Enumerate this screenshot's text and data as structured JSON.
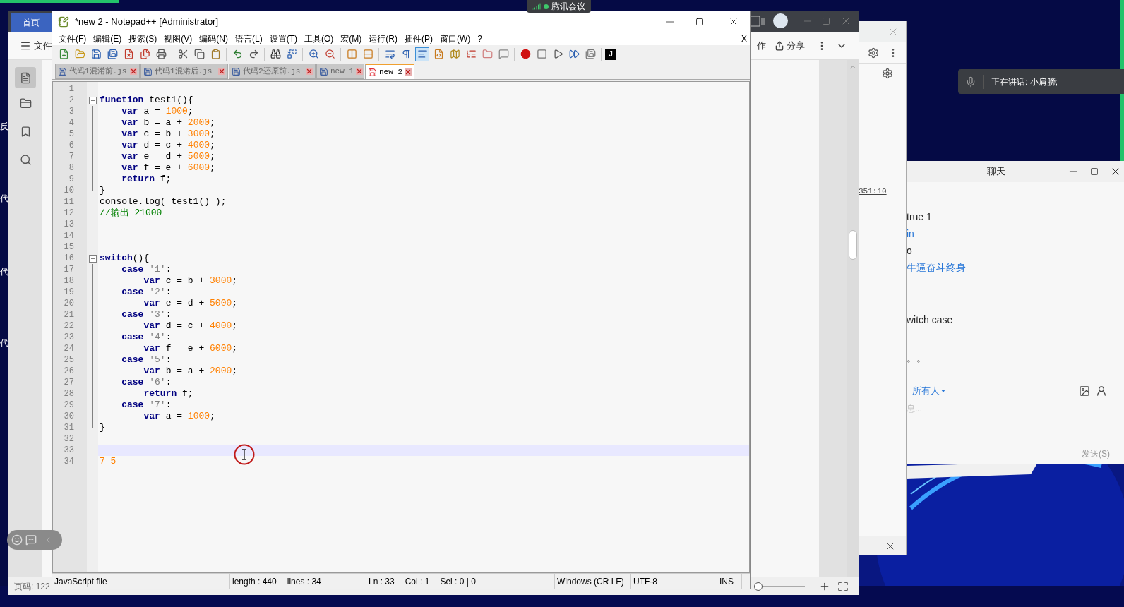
{
  "meeting_bar": {
    "title": "腾讯会议"
  },
  "speaking_notice": {
    "text": "正在讲话: 小肩膀;"
  },
  "desktop_labels": [
    "反",
    "代",
    "代",
    "代"
  ],
  "doc_window": {
    "home_tab": "首页",
    "file_menu": "文件",
    "collab": "作",
    "share": "分享",
    "page_info": "页码: 122",
    "zoom_slider": {
      "level": 0.05
    }
  },
  "devtools_window": {
    "link": "351:10"
  },
  "chat_window": {
    "title": "聊天",
    "messages": [
      {
        "kind": "text",
        "text": "true 1"
      },
      {
        "kind": "link",
        "text": "in"
      },
      {
        "kind": "text",
        "text": "o"
      },
      {
        "kind": "link",
        "text": "牛逼奋斗终身"
      },
      {
        "kind": "text",
        "text": "witch case"
      },
      {
        "kind": "text",
        "text": "。。"
      }
    ],
    "recipient": "所有人",
    "placeholder": "息...",
    "send": "发送(S)"
  },
  "notepad": {
    "title": "*new 2 - Notepad++ [Administrator]",
    "menu": [
      "文件(F)",
      "编辑(E)",
      "搜索(S)",
      "视图(V)",
      "编码(N)",
      "语言(L)",
      "设置(T)",
      "工具(O)",
      "宏(M)",
      "运行(R)",
      "插件(P)",
      "窗口(W)",
      "?"
    ],
    "close_doc": "X",
    "toolbar": [
      {
        "kind": "new",
        "pressed": false
      },
      {
        "kind": "open",
        "pressed": false
      },
      {
        "kind": "save",
        "pressed": false
      },
      {
        "kind": "saveall",
        "pressed": false
      },
      {
        "kind": "close",
        "pressed": false
      },
      {
        "kind": "closeall",
        "pressed": false
      },
      {
        "kind": "print",
        "pressed": false
      },
      {
        "kind": "sep"
      },
      {
        "kind": "cut",
        "pressed": false
      },
      {
        "kind": "copy",
        "pressed": false
      },
      {
        "kind": "paste",
        "pressed": false
      },
      {
        "kind": "sep"
      },
      {
        "kind": "undo",
        "pressed": false
      },
      {
        "kind": "redo",
        "pressed": false
      },
      {
        "kind": "sep"
      },
      {
        "kind": "find",
        "pressed": false
      },
      {
        "kind": "replace",
        "pressed": false
      },
      {
        "kind": "sep"
      },
      {
        "kind": "zoomin",
        "pressed": false
      },
      {
        "kind": "zoomout",
        "pressed": false
      },
      {
        "kind": "sep"
      },
      {
        "kind": "syncv",
        "pressed": false
      },
      {
        "kind": "synch",
        "pressed": false
      },
      {
        "kind": "sep"
      },
      {
        "kind": "wrap",
        "pressed": false
      },
      {
        "kind": "allchars",
        "pressed": false
      },
      {
        "kind": "indent",
        "pressed": true
      },
      {
        "kind": "udl",
        "pressed": false
      },
      {
        "kind": "docmap",
        "pressed": false
      },
      {
        "kind": "funclist",
        "pressed": false
      },
      {
        "kind": "folder",
        "pressed": false
      },
      {
        "kind": "monitor",
        "pressed": false
      },
      {
        "kind": "sep"
      },
      {
        "kind": "record",
        "pressed": false
      },
      {
        "kind": "stop",
        "pressed": false
      },
      {
        "kind": "play",
        "pressed": false
      },
      {
        "kind": "playmulti",
        "pressed": false
      },
      {
        "kind": "savemacro",
        "pressed": false
      },
      {
        "kind": "sep"
      },
      {
        "kind": "label",
        "text": "J",
        "pressed": false
      }
    ],
    "tabs": [
      {
        "label": "代码1混淆前.js",
        "selected": false,
        "modified": false
      },
      {
        "label": "代码1混淆后.js",
        "selected": false,
        "modified": false
      },
      {
        "label": "代码2还原前.js",
        "selected": false,
        "modified": false
      },
      {
        "label": "new 1",
        "selected": false,
        "modified": false
      },
      {
        "label": "new 2",
        "selected": true,
        "modified": true
      }
    ],
    "lines": [
      {
        "number": "1",
        "current": false,
        "kind": "plain"
      },
      {
        "number": "2",
        "current": false,
        "kind": "fold_start",
        "tokens": [
          {
            "kind": "kw",
            "text": "function"
          },
          {
            "kind": "plain",
            "text": " test1(){"
          }
        ]
      },
      {
        "number": "3",
        "current": false,
        "kind": "fold_line",
        "tokens": [
          {
            "kind": "kw",
            "text": "    var"
          },
          {
            "kind": "plain",
            "text": " a = "
          },
          {
            "kind": "num",
            "text": "1000"
          },
          {
            "kind": "plain",
            "text": ";"
          }
        ]
      },
      {
        "number": "4",
        "current": false,
        "kind": "fold_line",
        "tokens": [
          {
            "kind": "kw",
            "text": "    var"
          },
          {
            "kind": "plain",
            "text": " b = a + "
          },
          {
            "kind": "num",
            "text": "2000"
          },
          {
            "kind": "plain",
            "text": ";"
          }
        ]
      },
      {
        "number": "5",
        "current": false,
        "kind": "fold_line",
        "tokens": [
          {
            "kind": "kw",
            "text": "    var"
          },
          {
            "kind": "plain",
            "text": " c = b + "
          },
          {
            "kind": "num",
            "text": "3000"
          },
          {
            "kind": "plain",
            "text": ";"
          }
        ]
      },
      {
        "number": "6",
        "current": false,
        "kind": "fold_line",
        "tokens": [
          {
            "kind": "kw",
            "text": "    var"
          },
          {
            "kind": "plain",
            "text": " d = c + "
          },
          {
            "kind": "num",
            "text": "4000"
          },
          {
            "kind": "plain",
            "text": ";"
          }
        ]
      },
      {
        "number": "7",
        "current": false,
        "kind": "fold_line",
        "tokens": [
          {
            "kind": "kw",
            "text": "    var"
          },
          {
            "kind": "plain",
            "text": " e = d + "
          },
          {
            "kind": "num",
            "text": "5000"
          },
          {
            "kind": "plain",
            "text": ";"
          }
        ]
      },
      {
        "number": "8",
        "current": false,
        "kind": "fold_line",
        "tokens": [
          {
            "kind": "kw",
            "text": "    var"
          },
          {
            "kind": "plain",
            "text": " f = e + "
          },
          {
            "kind": "num",
            "text": "6000"
          },
          {
            "kind": "plain",
            "text": ";"
          }
        ]
      },
      {
        "number": "9",
        "current": false,
        "kind": "fold_line",
        "tokens": [
          {
            "kind": "kw",
            "text": "    return"
          },
          {
            "kind": "plain",
            "text": " f;"
          }
        ]
      },
      {
        "number": "10",
        "current": false,
        "kind": "fold_end",
        "tokens": [
          {
            "kind": "plain",
            "text": "}"
          }
        ]
      },
      {
        "number": "11",
        "current": false,
        "kind": "plain",
        "tokens": [
          {
            "kind": "plain",
            "text": "console.log( test1() );"
          }
        ]
      },
      {
        "number": "12",
        "current": false,
        "kind": "plain",
        "tokens": [
          {
            "kind": "cmt",
            "text": "//输出 21000"
          }
        ]
      },
      {
        "number": "13",
        "current": false,
        "kind": "plain"
      },
      {
        "number": "14",
        "current": false,
        "kind": "plain"
      },
      {
        "number": "15",
        "current": false,
        "kind": "plain"
      },
      {
        "number": "16",
        "current": false,
        "kind": "fold_start",
        "tokens": [
          {
            "kind": "kw",
            "text": "switch"
          },
          {
            "kind": "plain",
            "text": "(){"
          }
        ]
      },
      {
        "number": "17",
        "current": false,
        "kind": "fold_line",
        "tokens": [
          {
            "kind": "kw",
            "text": "    case"
          },
          {
            "kind": "str",
            "text": " '1'"
          },
          {
            "kind": "plain",
            "text": ":"
          }
        ]
      },
      {
        "number": "18",
        "current": false,
        "kind": "fold_line",
        "tokens": [
          {
            "kind": "kw",
            "text": "        var"
          },
          {
            "kind": "plain",
            "text": " c = b + "
          },
          {
            "kind": "num",
            "text": "3000"
          },
          {
            "kind": "plain",
            "text": ";"
          }
        ]
      },
      {
        "number": "19",
        "current": false,
        "kind": "fold_line",
        "tokens": [
          {
            "kind": "kw",
            "text": "    case"
          },
          {
            "kind": "str",
            "text": " '2'"
          },
          {
            "kind": "plain",
            "text": ":"
          }
        ]
      },
      {
        "number": "20",
        "current": false,
        "kind": "fold_line",
        "tokens": [
          {
            "kind": "kw",
            "text": "        var"
          },
          {
            "kind": "plain",
            "text": " e = d + "
          },
          {
            "kind": "num",
            "text": "5000"
          },
          {
            "kind": "plain",
            "text": ";"
          }
        ]
      },
      {
        "number": "21",
        "current": false,
        "kind": "fold_line",
        "tokens": [
          {
            "kind": "kw",
            "text": "    case"
          },
          {
            "kind": "str",
            "text": " '3'"
          },
          {
            "kind": "plain",
            "text": ":"
          }
        ]
      },
      {
        "number": "22",
        "current": false,
        "kind": "fold_line",
        "tokens": [
          {
            "kind": "kw",
            "text": "        var"
          },
          {
            "kind": "plain",
            "text": " d = c + "
          },
          {
            "kind": "num",
            "text": "4000"
          },
          {
            "kind": "plain",
            "text": ";"
          }
        ]
      },
      {
        "number": "23",
        "current": false,
        "kind": "fold_line",
        "tokens": [
          {
            "kind": "kw",
            "text": "    case"
          },
          {
            "kind": "str",
            "text": " '4'"
          },
          {
            "kind": "plain",
            "text": ":"
          }
        ]
      },
      {
        "number": "24",
        "current": false,
        "kind": "fold_line",
        "tokens": [
          {
            "kind": "kw",
            "text": "        var"
          },
          {
            "kind": "plain",
            "text": " f = e + "
          },
          {
            "kind": "num",
            "text": "6000"
          },
          {
            "kind": "plain",
            "text": ";"
          }
        ]
      },
      {
        "number": "25",
        "current": false,
        "kind": "fold_line",
        "tokens": [
          {
            "kind": "kw",
            "text": "    case"
          },
          {
            "kind": "str",
            "text": " '5'"
          },
          {
            "kind": "plain",
            "text": ":"
          }
        ]
      },
      {
        "number": "26",
        "current": false,
        "kind": "fold_line",
        "tokens": [
          {
            "kind": "kw",
            "text": "        var"
          },
          {
            "kind": "plain",
            "text": " b = a + "
          },
          {
            "kind": "num",
            "text": "2000"
          },
          {
            "kind": "plain",
            "text": ";"
          }
        ]
      },
      {
        "number": "27",
        "current": false,
        "kind": "fold_line",
        "tokens": [
          {
            "kind": "kw",
            "text": "    case"
          },
          {
            "kind": "str",
            "text": " '6'"
          },
          {
            "kind": "plain",
            "text": ":"
          }
        ]
      },
      {
        "number": "28",
        "current": false,
        "kind": "fold_line",
        "tokens": [
          {
            "kind": "kw",
            "text": "        return"
          },
          {
            "kind": "plain",
            "text": " f;"
          }
        ]
      },
      {
        "number": "29",
        "current": false,
        "kind": "fold_line",
        "tokens": [
          {
            "kind": "kw",
            "text": "    case"
          },
          {
            "kind": "str",
            "text": " '7'"
          },
          {
            "kind": "plain",
            "text": ":"
          }
        ]
      },
      {
        "number": "30",
        "current": false,
        "kind": "fold_line",
        "tokens": [
          {
            "kind": "kw",
            "text": "        var"
          },
          {
            "kind": "plain",
            "text": " a = "
          },
          {
            "kind": "num",
            "text": "1000"
          },
          {
            "kind": "plain",
            "text": ";"
          }
        ]
      },
      {
        "number": "31",
        "current": false,
        "kind": "fold_end",
        "tokens": [
          {
            "kind": "plain",
            "text": "}"
          }
        ]
      },
      {
        "number": "32",
        "current": false,
        "kind": "plain"
      },
      {
        "number": "33",
        "current": true,
        "kind": "plain"
      },
      {
        "number": "34",
        "current": false,
        "kind": "plain",
        "tokens": [
          {
            "kind": "num",
            "text": "7 5"
          }
        ]
      }
    ],
    "status_bar": [
      {
        "texts": [
          "JavaScript file"
        ]
      },
      {
        "texts": [
          "length : 440",
          "lines : 34"
        ]
      },
      {
        "texts": [
          "Ln : 33",
          "Col : 1",
          "Sel : 0 | 0"
        ]
      },
      {
        "texts": [
          "Windows (CR LF)"
        ]
      },
      {
        "texts": [
          "UTF-8"
        ]
      },
      {
        "texts": [
          "INS"
        ]
      }
    ]
  }
}
